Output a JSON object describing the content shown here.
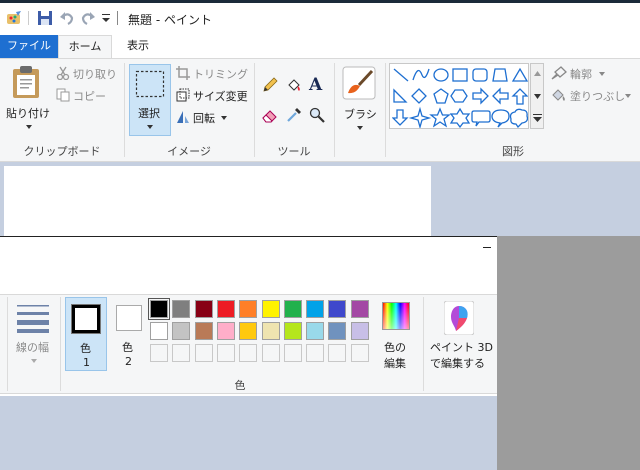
{
  "window": {
    "title": "無題 - ペイント"
  },
  "tabs": {
    "file": "ファイル",
    "home": "ホーム",
    "view": "表示"
  },
  "clipboard": {
    "paste": "貼り付け",
    "cut": "切り取り",
    "copy": "コピー",
    "group": "クリップボード"
  },
  "image": {
    "select": "選択",
    "crop": "トリミング",
    "resize": "サイズ変更",
    "rotate": "回転",
    "group": "イメージ"
  },
  "tools": {
    "group": "ツール"
  },
  "brush": {
    "label": "ブラシ"
  },
  "shapes": {
    "outline": "輪郭",
    "fill": "塗りつぶし",
    "group": "図形"
  },
  "size": {
    "label": "線の幅"
  },
  "colors": {
    "color1": "色",
    "color1_num": "1",
    "color2": "色",
    "color2_num": "2",
    "edit_line1": "色の",
    "edit_line2": "編集",
    "group": "色",
    "row1": [
      "#000000",
      "#7f7f7f",
      "#880015",
      "#ed1c24",
      "#ff7f27",
      "#fff200",
      "#22b14c",
      "#00a2e8",
      "#3f48cc",
      "#a349a4"
    ],
    "row2": [
      "#ffffff",
      "#c3c3c3",
      "#b97a57",
      "#ffaec9",
      "#ffc90e",
      "#efe4b0",
      "#b5e61d",
      "#99d9ea",
      "#7092be",
      "#c8bfe7"
    ]
  },
  "paint3d": {
    "line1": "ペイント 3D",
    "line2": "で編集する"
  }
}
